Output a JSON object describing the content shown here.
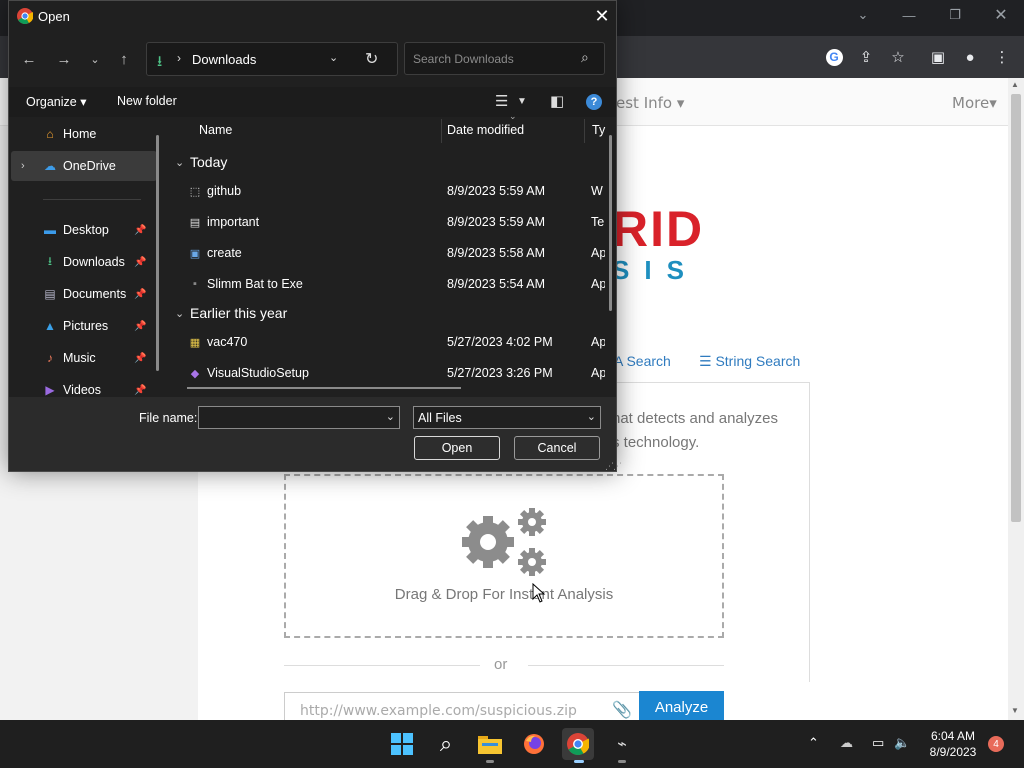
{
  "dialog": {
    "title": "Open",
    "address": {
      "location": "Downloads"
    },
    "search_placeholder": "Search Downloads",
    "commandbar": {
      "organize": "Organize",
      "new_folder": "New folder"
    },
    "nav_pane": {
      "home": "Home",
      "onedrive": "OneDrive",
      "quick_access": [
        {
          "label": "Desktop",
          "icon": "desktop-icon"
        },
        {
          "label": "Downloads",
          "icon": "download-icon"
        },
        {
          "label": "Documents",
          "icon": "documents-icon"
        },
        {
          "label": "Pictures",
          "icon": "pictures-icon"
        },
        {
          "label": "Music",
          "icon": "music-icon"
        },
        {
          "label": "Videos",
          "icon": "videos-icon"
        }
      ]
    },
    "columns": {
      "name": "Name",
      "date_modified": "Date modified",
      "type": "Ty"
    },
    "groups": [
      {
        "label": "Today",
        "files": [
          {
            "name": "github",
            "date": "8/9/2023 5:59 AM",
            "type": "W"
          },
          {
            "name": "important",
            "date": "8/9/2023 5:59 AM",
            "type": "Te"
          },
          {
            "name": "create",
            "date": "8/9/2023 5:58 AM",
            "type": "Ap"
          },
          {
            "name": "Slimm Bat to Exe",
            "date": "8/9/2023 5:54 AM",
            "type": "Ap"
          }
        ]
      },
      {
        "label": "Earlier this year",
        "files": [
          {
            "name": "vac470",
            "date": "5/27/2023 4:02 PM",
            "type": "Ap"
          },
          {
            "name": "VisualStudioSetup",
            "date": "5/27/2023 3:26 PM",
            "type": "Ap"
          }
        ]
      }
    ],
    "file_name_label": "File name:",
    "file_name_value": "",
    "filter_value": "All Files",
    "open_label": "Open",
    "cancel_label": "Cancel"
  },
  "webpage": {
    "nav": {
      "latest_info": "est Info",
      "more": "More"
    },
    "logo": {
      "line1": "RID",
      "line2": "SIS"
    },
    "tabs": {
      "search_a": "A Search",
      "string_search": "String Search"
    },
    "desc_line1": "hat detects and analyzes",
    "desc_line2": "s technology.",
    "dropzone_text": "Drag & Drop For Instant Analysis",
    "or_text": "or",
    "url_placeholder": "http://www.example.com/suspicious.zip",
    "analyze_label": "Analyze"
  },
  "taskbar": {
    "time": "6:04 AM",
    "date": "8/9/2023",
    "notification_count": "4"
  },
  "colors": {
    "dialog_bg": "#202020",
    "accent_blue": "#1b86d1",
    "logo_red": "#d9222a",
    "logo_blue": "#1e8fbf"
  }
}
